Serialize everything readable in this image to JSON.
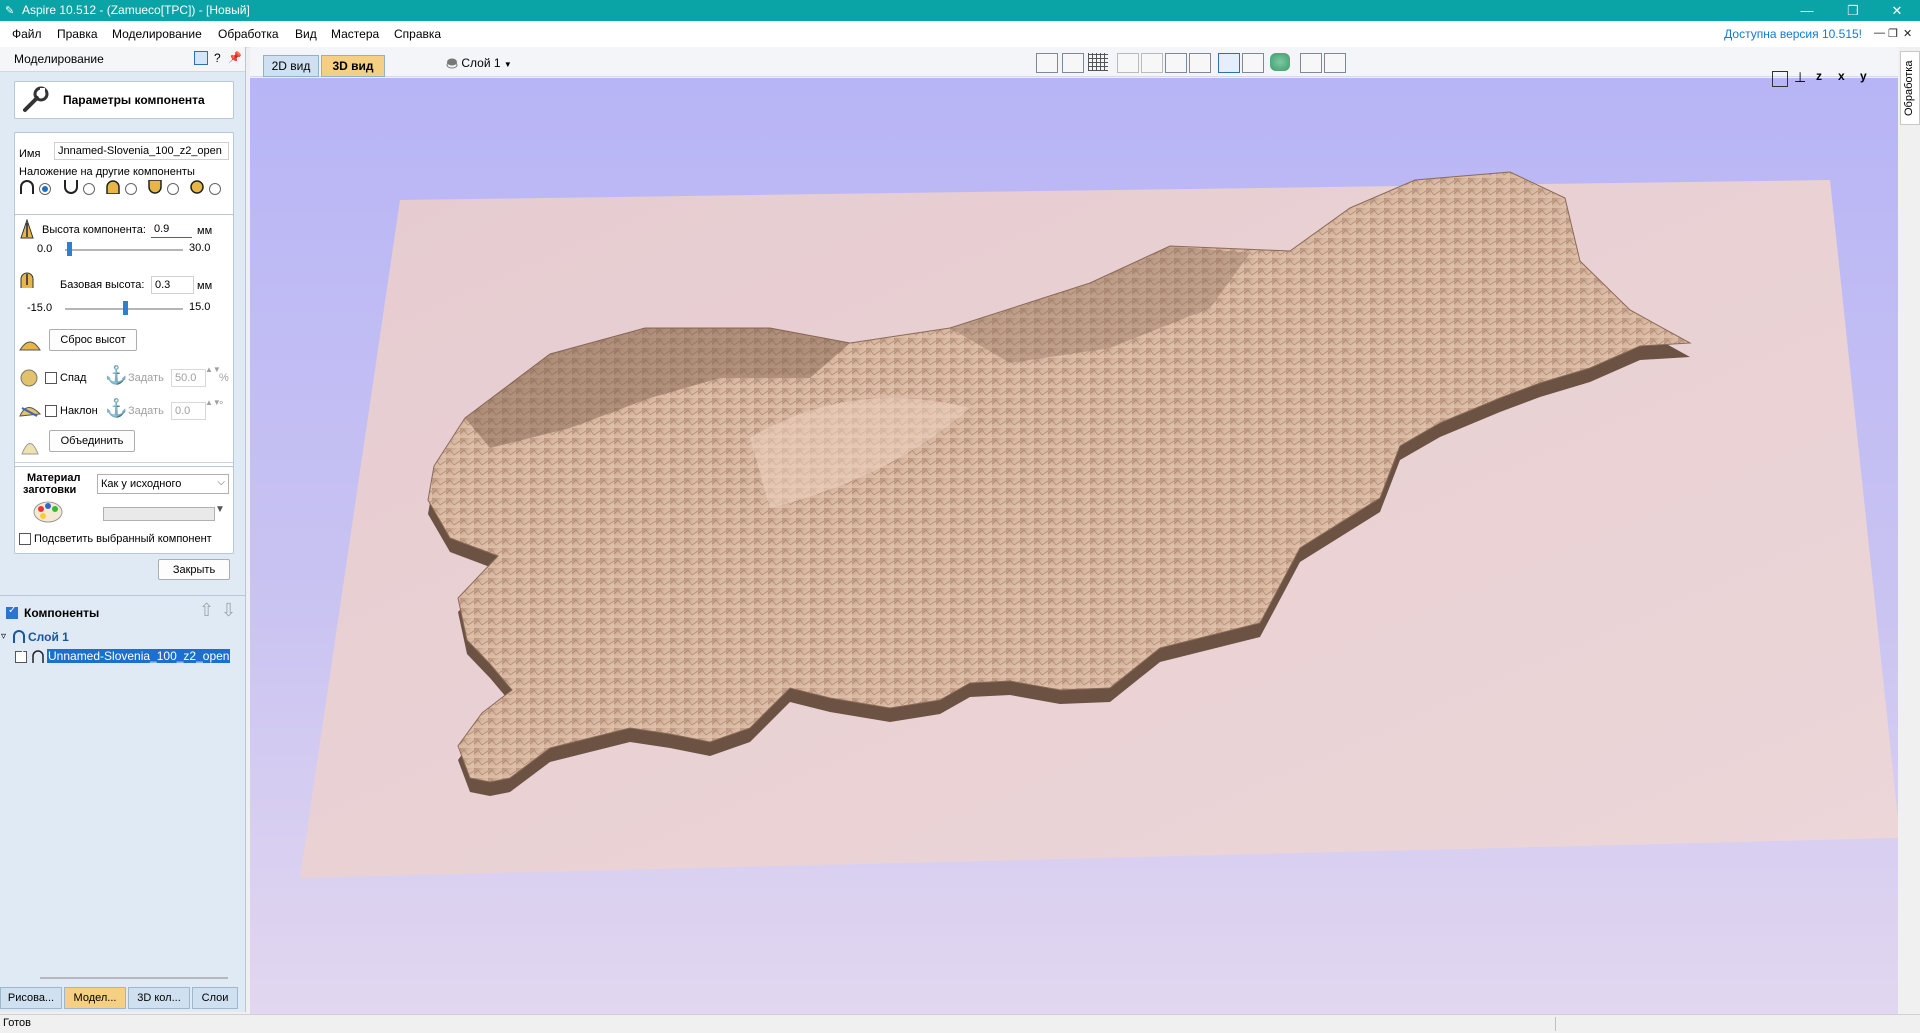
{
  "window": {
    "title": "Aspire 10.512 - (Zamueco[TPC]) - [Новый]",
    "minimize": "—",
    "restore": "❐",
    "close": "✕"
  },
  "menu": {
    "items": [
      "Файл",
      "Правка",
      "Моделирование",
      "Обработка",
      "Вид",
      "Мастера",
      "Справка"
    ],
    "update_notice": "Доступна версия 10.515!"
  },
  "left_panel": {
    "title": "Моделирование",
    "help": "?",
    "component_params": {
      "header": "Параметры компонента",
      "name_label": "Имя",
      "name_value": "Jnnamed-Slovenia_100_z2_open",
      "overlay_label": "Наложение на другие компоненты",
      "height_label": "Высота компонента:",
      "height_value": "0.9",
      "height_unit": "мм",
      "height_min": "0.0",
      "height_max": "30.0",
      "height_level": 0.03,
      "base_label": "Базовая высота:",
      "base_value": "0.3",
      "base_unit": "мм",
      "base_min": "-15.0",
      "base_max": "15.0",
      "base_level": 0.51,
      "reset_button": "Сброс высот",
      "fade_label": "Спад",
      "fade_set": "Задать",
      "fade_value": "50.0",
      "fade_unit": "%",
      "tilt_label": "Наклон",
      "tilt_set": "Задать",
      "tilt_value": "0.0",
      "tilt_unit": "°",
      "merge_button": "Объединить"
    },
    "material": {
      "label_line1": "Материал",
      "label_line2": "заготовки",
      "select_value": "Как у исходного",
      "highlight_label": "Подсветить выбранный компонент"
    },
    "close_button": "Закрыть",
    "components": {
      "header": "Компоненты",
      "layer_name": "Слой 1",
      "item_name": "Unnamed-Slovenia_100_z2_open"
    },
    "bottom_tabs": [
      "Рисова...",
      "Модел...",
      "3D кол...",
      "Слои"
    ]
  },
  "toolbar": {
    "tab_2d": "2D вид",
    "tab_3d": "3D вид",
    "layer": "Слой 1"
  },
  "view_axes": [
    "z",
    "x",
    "y"
  ],
  "right_strip_label": "Обработка",
  "status": "Готов",
  "colors": {
    "titlebar": "#0aa3a6",
    "accent": "#1c6fc8",
    "tab_3d": "#f5cf82",
    "relief": "#d8b39a"
  }
}
